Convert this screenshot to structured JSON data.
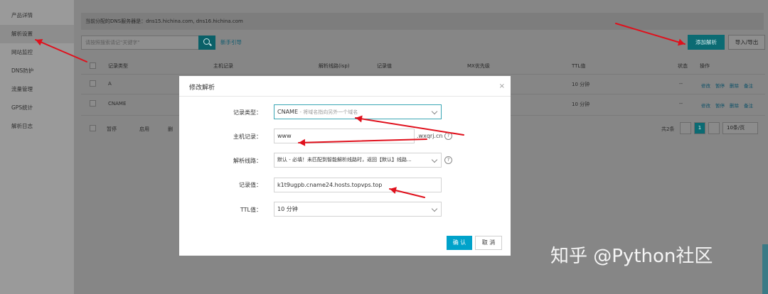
{
  "sidebar": {
    "items": [
      {
        "label": "产品详情",
        "active": false
      },
      {
        "label": "解析设置",
        "active": true
      },
      {
        "label": "网站监控",
        "active": false
      },
      {
        "label": "DNS防护",
        "active": false
      },
      {
        "label": "流量管理",
        "active": false
      },
      {
        "label": "GPS统计",
        "active": false
      },
      {
        "label": "解析日志",
        "active": false
      }
    ]
  },
  "main": {
    "dns_servers": "当前分配的DNS服务器是：dns15.hichina.com, dns16.hichina.com",
    "search_placeholder": "请按照搜索请记\"关键字\"",
    "guide_link": "新手引导",
    "add_button": "添加解析",
    "import_export_button": "导入/导出"
  },
  "table": {
    "headers": [
      "记录类型",
      "主机记录",
      "解析线路(isp)",
      "记录值",
      "MX优先级",
      "TTL值",
      "状态",
      "操作"
    ],
    "rows": [
      {
        "type": "A",
        "ttl": "10 分钟",
        "status": "--",
        "actions": [
          "修改",
          "暂停",
          "删除",
          "备注"
        ]
      },
      {
        "type": "CNAME",
        "ttl": "10 分钟",
        "status": "--",
        "actions": [
          "修改",
          "暂停",
          "删除",
          "备注"
        ]
      }
    ],
    "footer_buttons": [
      "暂停",
      "启用",
      "删"
    ],
    "total": "共2条",
    "current_page": "1",
    "page_size": "10条/页"
  },
  "modal": {
    "title": "修改解析",
    "close_glyph": "×",
    "fields": {
      "record_type": {
        "label": "记录类型：",
        "value": "CNAME",
        "hint": "- 将域名指向另外一个域名"
      },
      "host": {
        "label": "主机记录：",
        "value": "www",
        "suffix": ".wxqrj.cn"
      },
      "line": {
        "label": "解析线路：",
        "value": "默认 - 必填！未匹配到智能解析线路时，返回【默认】线路..."
      },
      "record_value": {
        "label": "记录值：",
        "value": "k1t9ugpb.cname24.hosts.topvps.top"
      },
      "ttl": {
        "label": "TTL值：",
        "value": "10 分钟"
      }
    },
    "help_glyph": "?",
    "confirm_button": "确 认",
    "cancel_button": "取 消"
  },
  "annotations": {
    "arrow_color": "#e0101c"
  },
  "watermark": "知乎 @Python社区"
}
